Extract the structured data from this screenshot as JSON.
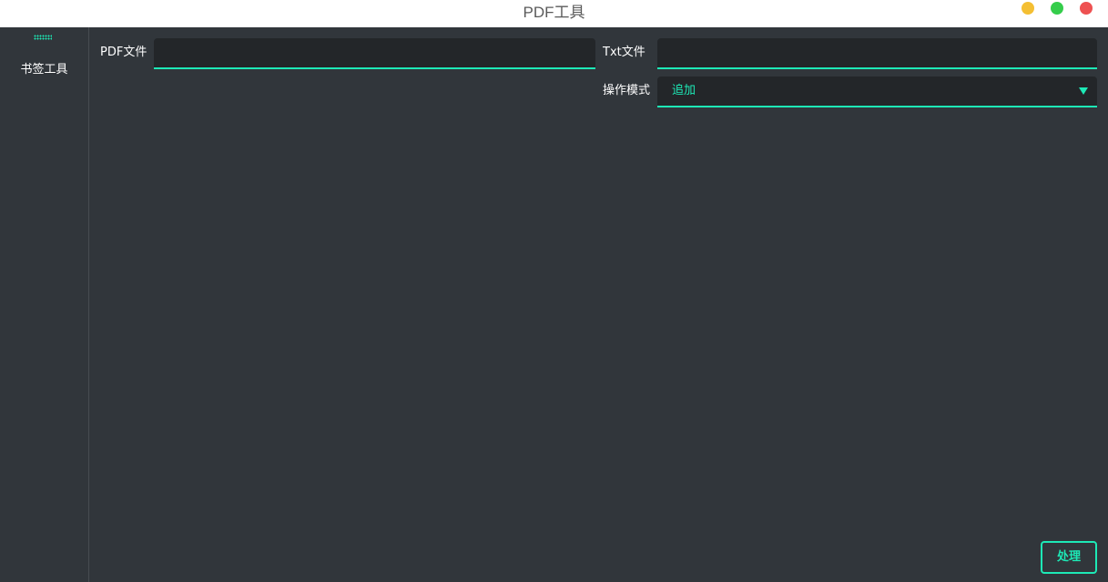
{
  "window": {
    "title": "PDF工具"
  },
  "sidebar": {
    "items": [
      {
        "label": "书签工具"
      }
    ]
  },
  "form": {
    "pdf_label": "PDF文件",
    "pdf_value": "",
    "txt_label": "Txt文件",
    "txt_value": "",
    "mode_label": "操作模式",
    "mode_selected": "追加"
  },
  "actions": {
    "process_label": "处理"
  },
  "colors": {
    "accent": "#1de9b6",
    "background": "#31363b",
    "input_background": "#232629",
    "minimize": "#f4bf33",
    "maximize": "#35cd4b",
    "close": "#ee5151"
  }
}
